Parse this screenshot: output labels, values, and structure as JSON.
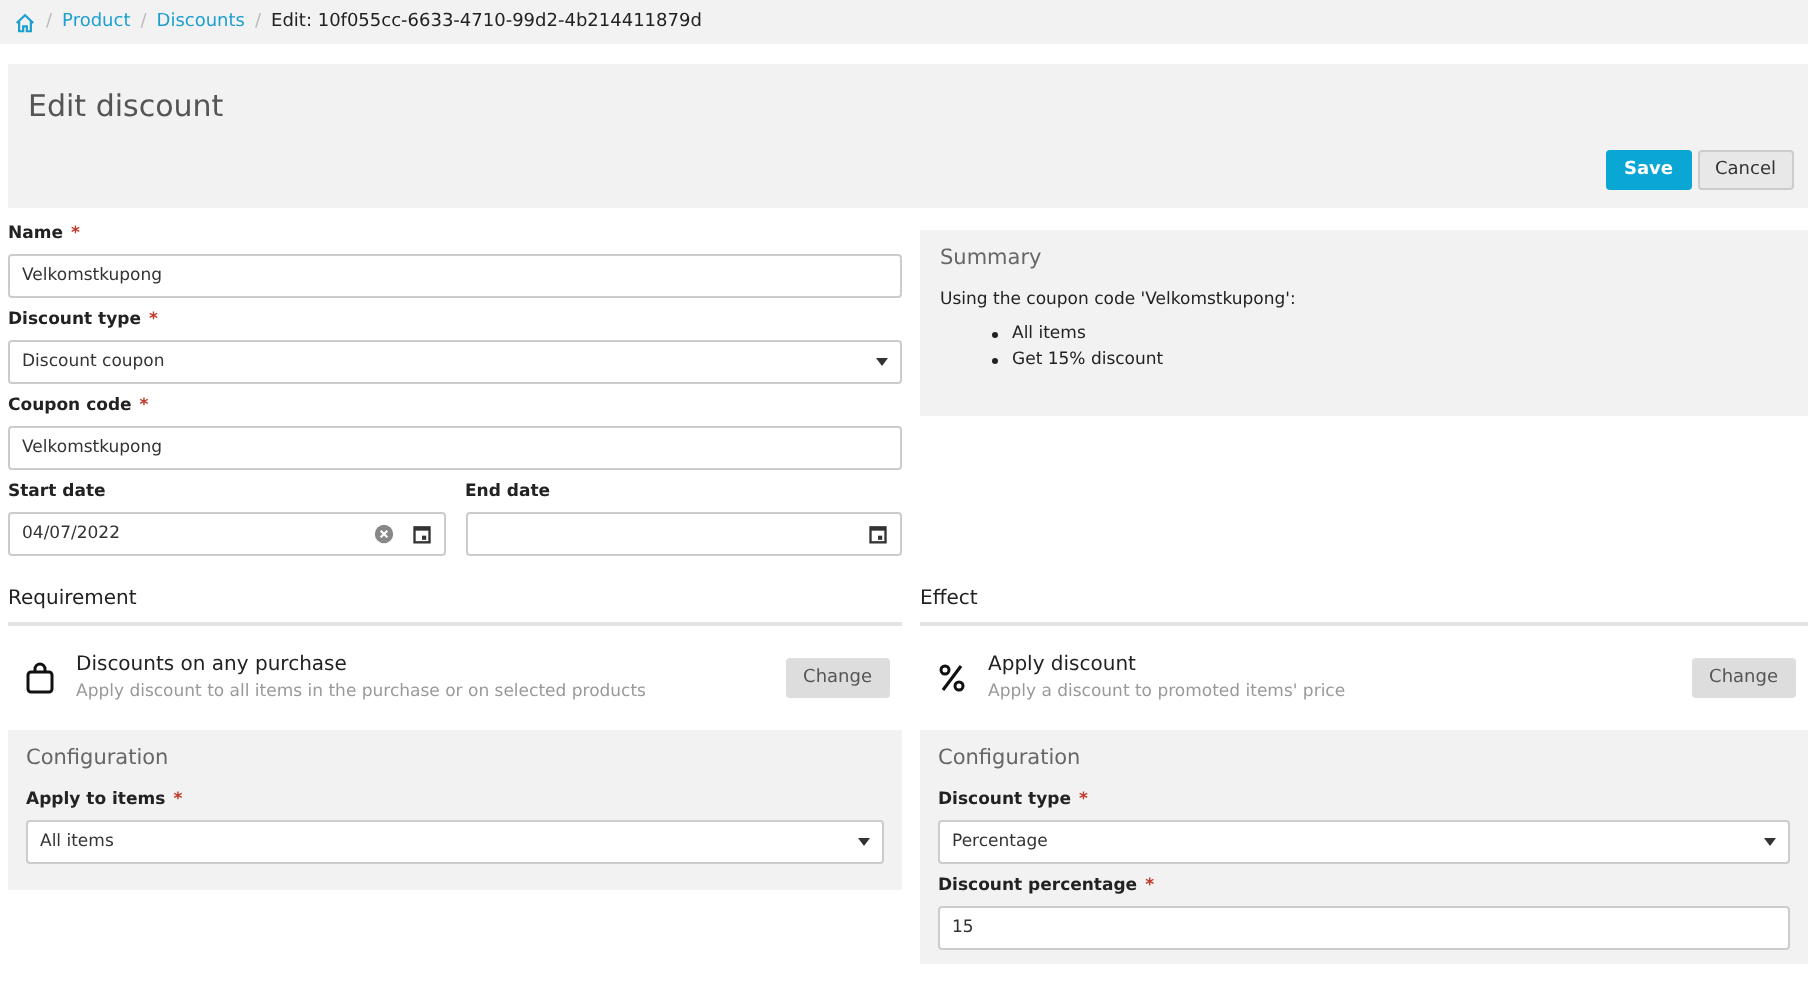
{
  "breadcrumb": [
    {
      "kind": "separator",
      "text": "/"
    },
    {
      "kind": "link",
      "text": "Product"
    },
    {
      "kind": "separator",
      "text": "/"
    },
    {
      "kind": "link",
      "text": "Discounts"
    },
    {
      "kind": "separator",
      "text": "/"
    },
    {
      "kind": "current",
      "text": "Edit: 10f055cc-6633-4710-99d2-4b214411879d"
    }
  ],
  "header": {
    "title": "Edit discount",
    "buttons": [
      {
        "label": "Save",
        "kind": "primary"
      },
      {
        "label": "Cancel",
        "kind": "secondary"
      }
    ]
  },
  "fields": [
    {
      "label": "Name",
      "mark": "*",
      "kind": "text",
      "value": "Velkomstkupong"
    },
    {
      "label": "Discount type",
      "mark": "*",
      "kind": "select",
      "value": "Discount coupon"
    },
    {
      "label": "Coupon code",
      "mark": "*",
      "kind": "text",
      "value": "Velkomstkupong"
    }
  ],
  "dates": [
    {
      "label": "Start date",
      "value": "04/07/2022"
    },
    {
      "label": "End date"
    }
  ],
  "summary": {
    "title": "Summary",
    "intro": "Using the coupon code 'Velkomstkupong':",
    "items": [
      "All items",
      "Get 15% discount"
    ]
  },
  "sections": [
    {
      "heading": "Requirement",
      "kind": "purchase",
      "title": "Discounts on any purchase",
      "description": "Apply discount to all items in the purchase or on selected products",
      "button": "Change",
      "configuration": {
        "title": "Configuration",
        "fields": [
          {
            "label": "Apply to items",
            "mark": "*",
            "kind": "select",
            "value": "All items"
          }
        ]
      }
    },
    {
      "heading": "Effect",
      "kind": "discount",
      "title": "Apply discount",
      "description": "Apply a discount to promoted items' price",
      "button": "Change",
      "configuration": {
        "title": "Configuration",
        "fields": [
          {
            "label": "Discount type",
            "mark": "*",
            "kind": "select",
            "value": "Percentage"
          },
          {
            "label": "Discount percentage",
            "mark": "*",
            "kind": "text",
            "value": "15"
          }
        ]
      }
    }
  ]
}
